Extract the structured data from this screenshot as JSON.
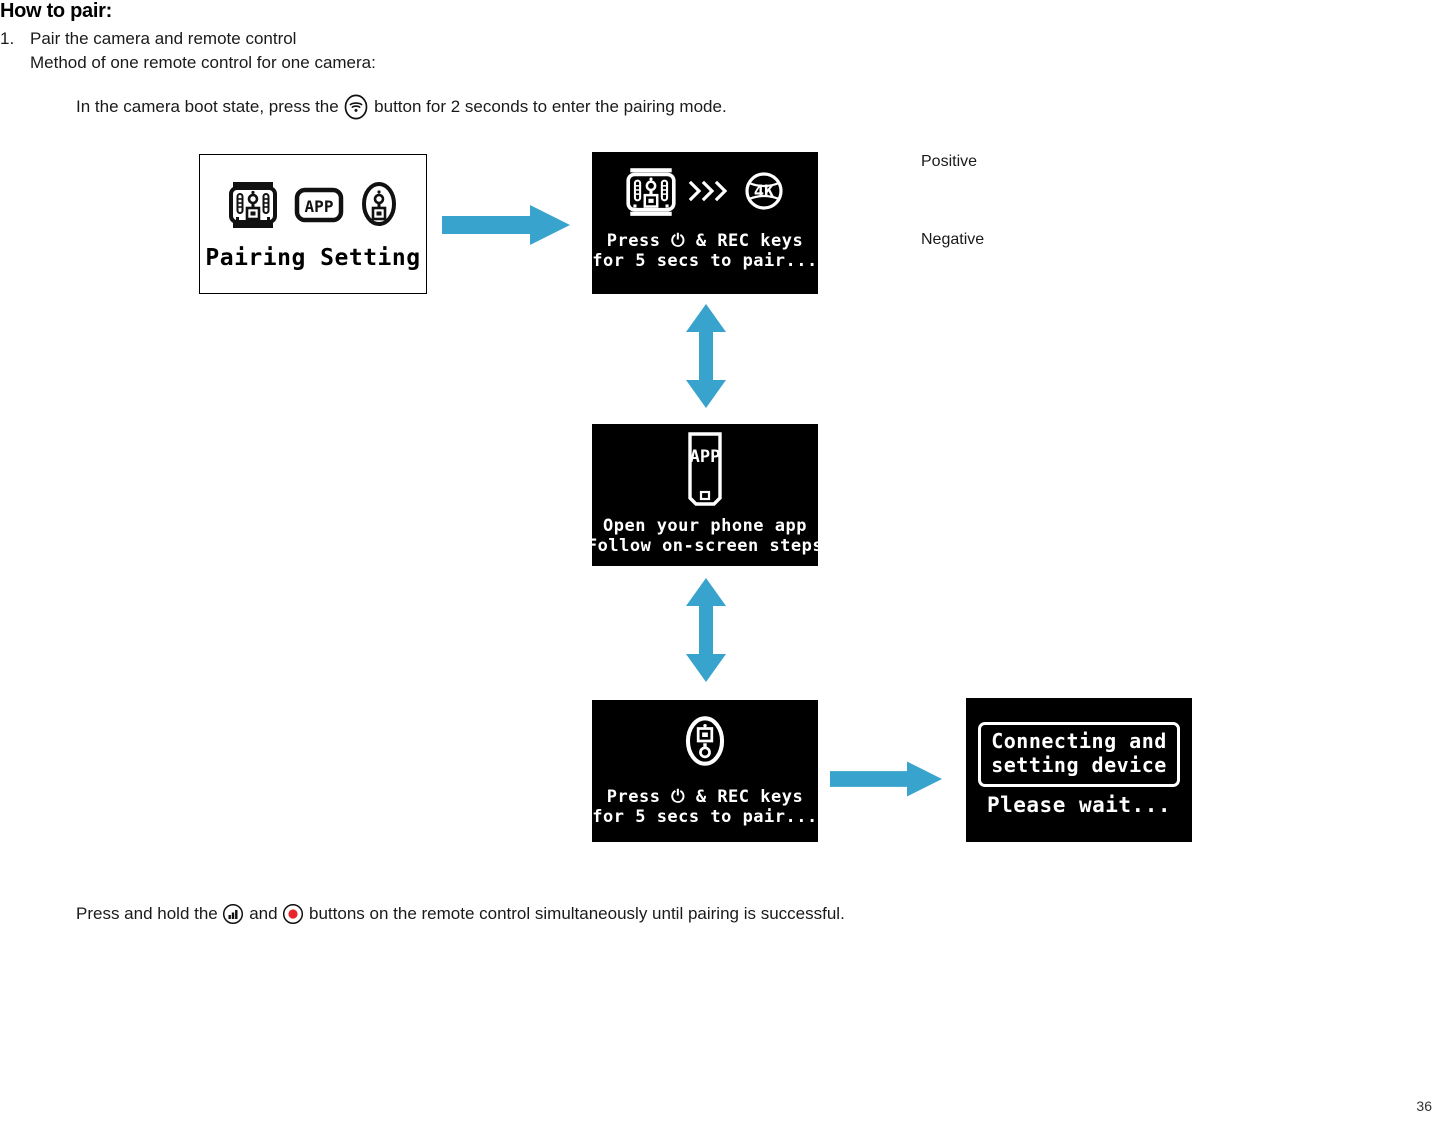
{
  "document": {
    "heading": "How to pair:",
    "step_number": "1.",
    "step_text": "Pair the camera and remote control",
    "step_subtext": "Method of one remote control for one camera:",
    "instruction_before_icon": "In the camera boot state, press the ",
    "instruction_after_icon": " button for 2 seconds to enter the pairing mode.",
    "bottom_before_icon1": "Press and hold the ",
    "bottom_between_icons": " and ",
    "bottom_after_icon2": " buttons on the remote control simultaneously until pairing is successful.",
    "page_number": "36"
  },
  "side_labels": {
    "positive": "Positive",
    "negative": "Negative"
  },
  "icons": {
    "wifi": "wifi-icon",
    "signal": "signal-bars-icon",
    "record": "record-button-icon",
    "arrow_right": "arrow-right-icon",
    "arrow_updown": "arrow-up-down-icon"
  },
  "colors": {
    "arrow_blue": "#38A3CD",
    "record_red": "#E8252A",
    "screen_black": "#000000",
    "screen_white": "#FFFFFF",
    "text": "#1A1A1A"
  },
  "screens": [
    {
      "id": "pairing-setting",
      "theme": "white",
      "icons": [
        "remote-control-icon",
        "app-box-icon",
        "oval-remote-icon"
      ],
      "label": "Pairing Setting"
    },
    {
      "id": "press-rec-camera",
      "theme": "black",
      "icons": [
        "remote-control-icon",
        "chevrons-right-icon",
        "camera-4k-icon"
      ],
      "line1": "Press ⏻ & REC keys",
      "line2": "for 5 secs to pair..."
    },
    {
      "id": "open-phone-app",
      "theme": "black",
      "icons": [
        "phone-app-icon"
      ],
      "line1": "Open your phone app",
      "line2": "Follow on-screen steps"
    },
    {
      "id": "press-rec-remote",
      "theme": "black",
      "icons": [
        "oval-remote-icon"
      ],
      "line1": "Press ⏻ & REC keys",
      "line2": "for 5 secs to pair..."
    },
    {
      "id": "connecting-device",
      "theme": "black",
      "box_line1": "Connecting and",
      "box_line2": "setting device",
      "line3": "Please wait..."
    }
  ]
}
